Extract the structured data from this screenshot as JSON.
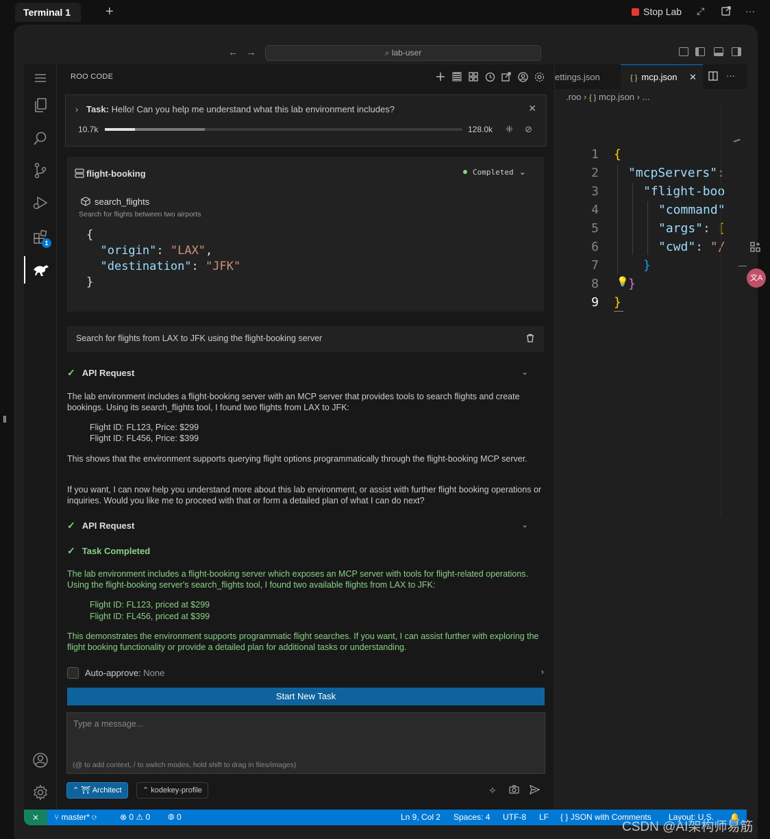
{
  "host": {
    "tab_title": "Terminal 1",
    "add_tab": "+",
    "stop_lab": "Stop Lab",
    "more": "···"
  },
  "titlebar": {
    "search_text": "lab-user",
    "back": "←",
    "forward": "→"
  },
  "activity": {
    "extensions_badge": "1"
  },
  "panel": {
    "title": "ROO CODE",
    "task": {
      "label": "Task:",
      "text": "Hello! Can you help me understand what this lab environment includes?",
      "tokens_used": "10.7k",
      "tokens_max": "128.0k",
      "progress_fraction": 0.084,
      "progress_secondary_fraction": 0.28
    },
    "mcp": {
      "server": "flight-booking",
      "status": "Completed",
      "tool": "search_flights",
      "tool_desc": "Search for flights between two airports",
      "args_open": "{",
      "arg1_key": "\"origin\"",
      "arg1_val": "\"LAX\"",
      "arg2_key": "\"destination\"",
      "arg2_val": "\"JFK\"",
      "args_close": "}"
    },
    "instruction": "Search for flights from LAX to JFK using the flight-booking server",
    "api_request_1": "API Request",
    "response_p1": "The lab environment includes a flight-booking server with an MCP server that provides tools to search flights and create bookings. Using its search_flights tool, I found two flights from LAX to JFK:",
    "response_f1": "Flight ID: FL123, Price: $299",
    "response_f2": "Flight ID: FL456, Price: $399",
    "response_p2": "This shows that the environment supports querying flight options programmatically through the flight-booking MCP server.",
    "response_p3": "If you want, I can now help you understand more about this lab environment, or assist with further flight booking operations or inquiries. Would you like me to proceed with that or form a detailed plan of what I can do next?",
    "api_request_2": "API Request",
    "task_completed": "Task Completed",
    "done_p1": "The lab environment includes a flight-booking server which exposes an MCP server with tools for flight-related operations. Using the flight-booking server's search_flights tool, I found two available flights from LAX to JFK:",
    "done_f1": "Flight ID: FL123, priced at $299",
    "done_f2": "Flight ID: FL456, priced at $399",
    "done_p2": "This demonstrates the environment supports programmatic flight searches. If you want, I can assist further with exploring the flight booking functionality or provide a detailed plan for additional tasks or understanding.",
    "auto_approve_label": "Auto-approve:",
    "auto_approve_value": "None",
    "start_new_task": "Start New Task",
    "message_placeholder": "Type a message...",
    "message_hint": "(@ to add context, / to switch modes, hold shift to drag in files/images)",
    "mode": "Architect",
    "profile": "kodekey-profile"
  },
  "editor": {
    "tab_inactive": "ettings.json",
    "tab_active": "mcp.json",
    "breadcrumb_folder": ".roo",
    "breadcrumb_file": "mcp.json",
    "breadcrumb_more": "...",
    "line_numbers": [
      "1",
      "2",
      "3",
      "4",
      "5",
      "6",
      "7",
      "8",
      "9"
    ],
    "code_mcpServers": "\"mcpServers\"",
    "code_flight": "\"flight-boo",
    "code_command": "\"command\"",
    "code_args": "\"args\"",
    "code_cwd": "\"cwd\"",
    "code_cwd_val": "\"/"
  },
  "statusbar": {
    "branch": "master*",
    "errors": "0",
    "warnings": "0",
    "ports": "0",
    "position": "Ln 9, Col 2",
    "spaces": "Spaces: 4",
    "encoding": "UTF-8",
    "eol": "LF",
    "language": "JSON with Comments",
    "layout": "Layout: U.S."
  },
  "watermark": "CSDN @AI架构师易筋",
  "colors": {
    "accent": "#0078d4",
    "success": "#89d185",
    "button": "#0e639c",
    "stop": "#e53935"
  }
}
